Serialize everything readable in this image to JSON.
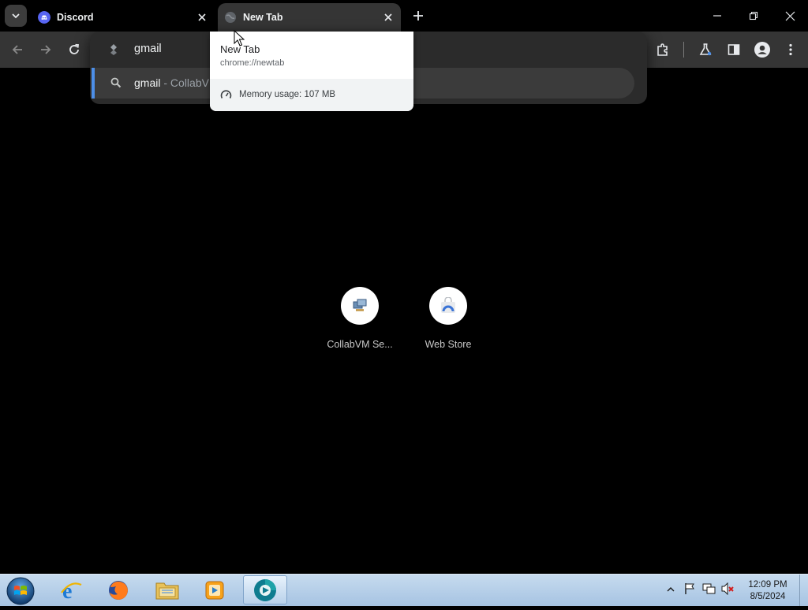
{
  "tabs": [
    {
      "title": "Discord",
      "favicon": "discord-icon"
    },
    {
      "title": "New Tab",
      "favicon": "globe-icon",
      "active": true
    }
  ],
  "omnibox": {
    "input_value": "gmail",
    "suggestion_query": "gmail",
    "suggestion_separator": " - ",
    "suggestion_source": "CollabV"
  },
  "hover_card": {
    "title": "New Tab",
    "url": "chrome://newtab",
    "memory": "Memory usage: 107 MB"
  },
  "shortcuts": [
    {
      "label": "CollabVM Se...",
      "icon": "collabvm-icon"
    },
    {
      "label": "Web Store",
      "icon": "webstore-icon"
    }
  ],
  "taskbar": {
    "apps": [
      "internet-explorer-icon",
      "firefox-icon",
      "file-explorer-icon",
      "media-player-icon",
      "chrome-app-icon"
    ],
    "time": "12:09 PM",
    "date": "8/5/2024"
  },
  "colors": {
    "accent_blue": "#4d8fe8",
    "discord": "#5865f2"
  }
}
